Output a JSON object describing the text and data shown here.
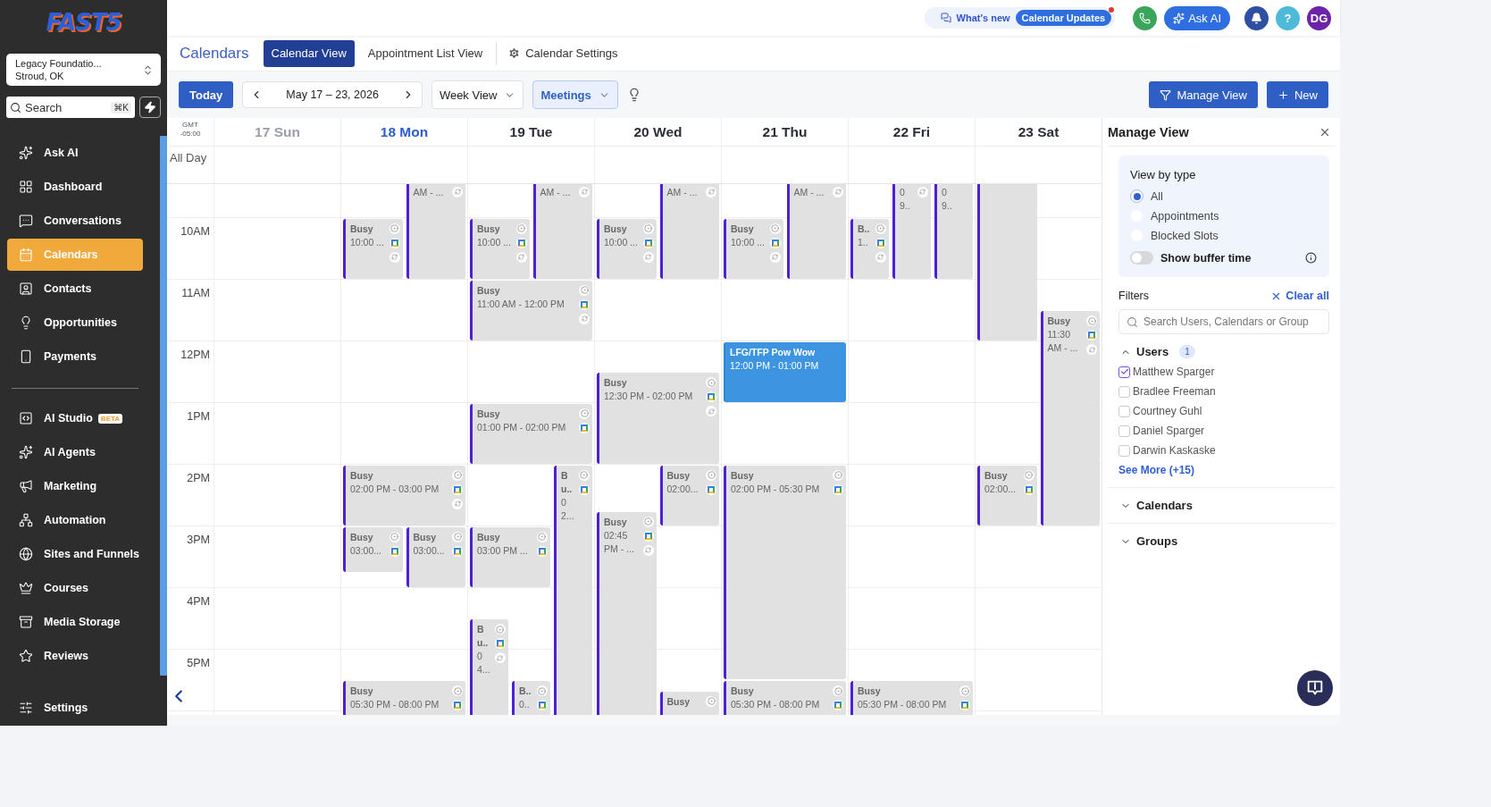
{
  "sidebar": {
    "logo": "FAST5",
    "location": {
      "name": "Legacy Foundatio...",
      "city": "Stroud, OK"
    },
    "search": {
      "placeholder": "Search",
      "shortcut": "⌘K"
    },
    "sections": [
      {
        "items": [
          {
            "label": "Ask AI",
            "selected": false
          },
          {
            "label": "Dashboard",
            "selected": false
          },
          {
            "label": "Conversations",
            "selected": false
          },
          {
            "label": "Calendars",
            "selected": true
          },
          {
            "label": "Contacts",
            "selected": false
          },
          {
            "label": "Opportunities",
            "selected": false
          },
          {
            "label": "Payments",
            "selected": false
          }
        ]
      },
      {
        "items": [
          {
            "label": "AI Studio",
            "badge": "BETA",
            "selected": false
          },
          {
            "label": "AI Agents",
            "selected": false
          },
          {
            "label": "Marketing",
            "selected": false
          },
          {
            "label": "Automation",
            "selected": false
          },
          {
            "label": "Sites and Funnels",
            "selected": false
          },
          {
            "label": "Courses",
            "selected": false
          },
          {
            "label": "Media Storage",
            "selected": false
          },
          {
            "label": "Reviews",
            "selected": false
          }
        ]
      }
    ],
    "footer_items": [
      {
        "label": "Settings",
        "selected": false
      }
    ]
  },
  "topbar": {
    "whats_new": "What's new",
    "updates": {
      "label": "Calendar Updates",
      "unread": true
    },
    "ask_ai": "Ask AI",
    "help": "?",
    "avatar": "DG"
  },
  "header": {
    "title": "Calendars",
    "tabs": [
      {
        "label": "Calendar View",
        "selected": true
      },
      {
        "label": "Appointment List View",
        "selected": false
      }
    ],
    "settings": "Calendar Settings"
  },
  "toolbar": {
    "today": "Today",
    "range": "May 17 – 23, 2026",
    "view": "Week View",
    "filter": "Meetings",
    "manage": "Manage View",
    "new": "New"
  },
  "calendar": {
    "timezone": [
      "GMT",
      "-05:00"
    ],
    "all_day": "All Day",
    "hours": [
      "10AM",
      "11AM",
      "12PM",
      "1PM",
      "2PM",
      "3PM",
      "4PM",
      "5PM"
    ],
    "days": [
      {
        "label": "17 Sun",
        "past": true,
        "today": false
      },
      {
        "label": "18 Mon",
        "past": false,
        "today": true,
        "events": [
          {
            "kind": "busy",
            "time": [
              "AM - ..."
            ]
          },
          {
            "kind": "busy",
            "title": [
              "Busy"
            ],
            "time": [
              "10:00 ..."
            ]
          },
          {
            "kind": "busy",
            "title": [
              "Busy"
            ],
            "time": [
              "02:00 PM - 03:00 PM"
            ]
          },
          {
            "kind": "busy",
            "title": [
              "Busy"
            ],
            "time": [
              "03:00..."
            ]
          },
          {
            "kind": "busy",
            "title": [
              "Busy"
            ],
            "time": [
              "03:00..."
            ]
          },
          {
            "kind": "busy",
            "title": [
              "Busy"
            ],
            "time": [
              "05:30 PM - 08:00 PM"
            ]
          }
        ]
      },
      {
        "label": "19 Tue",
        "past": false,
        "today": false,
        "events": [
          {
            "kind": "busy",
            "time": [
              "AM - ..."
            ]
          },
          {
            "kind": "busy",
            "title": [
              "Busy"
            ],
            "time": [
              "10:00 ..."
            ]
          },
          {
            "kind": "busy",
            "title": [
              "Busy"
            ],
            "time": [
              "11:00 AM - 12:00 PM"
            ]
          },
          {
            "kind": "busy",
            "title": [
              "Busy"
            ],
            "time": [
              "01:00 PM - 02:00 PM"
            ]
          },
          {
            "kind": "busy",
            "title": [
              "B",
              "u.."
            ],
            "time": [
              "0",
              "2..."
            ]
          },
          {
            "kind": "busy",
            "title": [
              "Busy"
            ],
            "time": [
              "03:00 PM ..."
            ]
          },
          {
            "kind": "busy",
            "title": [
              "B",
              "u.."
            ],
            "time": [
              "0",
              "4..."
            ]
          },
          {
            "kind": "busy",
            "title": [
              "B.."
            ],
            "time": [
              "0.."
            ]
          }
        ]
      },
      {
        "label": "20 Wed",
        "past": false,
        "today": false,
        "events": [
          {
            "kind": "busy",
            "time": [
              "AM - ..."
            ]
          },
          {
            "kind": "busy",
            "title": [
              "Busy"
            ],
            "time": [
              "10:00 ..."
            ]
          },
          {
            "kind": "busy",
            "title": [
              "Busy"
            ],
            "time": [
              "12:30 PM - 02:00 PM"
            ]
          },
          {
            "kind": "busy",
            "title": [
              "Busy"
            ],
            "time": [
              "02:00..."
            ]
          },
          {
            "kind": "busy",
            "title": [
              "Busy"
            ],
            "time": [
              "02:45",
              "PM - ..."
            ]
          },
          {
            "kind": "busy",
            "title": [
              "Busy"
            ]
          }
        ]
      },
      {
        "label": "21 Thu",
        "past": false,
        "today": false,
        "events": [
          {
            "kind": "busy",
            "time": [
              "AM - ..."
            ]
          },
          {
            "kind": "busy",
            "title": [
              "Busy"
            ],
            "time": [
              "10:00 ..."
            ]
          },
          {
            "kind": "meeting",
            "title": [
              "LFG/TFP Pow Wow"
            ],
            "time": [
              "12:00 PM - 01:00 PM"
            ]
          },
          {
            "kind": "busy",
            "title": [
              "Busy"
            ],
            "time": [
              "02:00 PM - 05:30 PM"
            ]
          },
          {
            "kind": "busy",
            "title": [
              "Busy"
            ],
            "time": [
              "05:30 PM - 08:00 PM"
            ]
          }
        ]
      },
      {
        "label": "22 Fri",
        "past": false,
        "today": false,
        "events": [
          {
            "kind": "busy",
            "time": [
              "0",
              "9.."
            ]
          },
          {
            "kind": "busy",
            "time": [
              "0",
              "9.."
            ]
          },
          {
            "kind": "busy",
            "title": [
              "B.."
            ],
            "time": [
              "1.."
            ]
          },
          {
            "kind": "busy",
            "title": [
              "Busy"
            ],
            "time": [
              "05:30 PM - 08:00 PM"
            ]
          }
        ]
      },
      {
        "label": "23 Sat",
        "past": false,
        "today": false,
        "events": [
          {
            "kind": "busy"
          },
          {
            "kind": "busy",
            "title": [
              "Busy"
            ],
            "time": [
              "11:30",
              "AM - ..."
            ]
          },
          {
            "kind": "busy",
            "title": [
              "Busy"
            ],
            "time": [
              "02:00..."
            ]
          }
        ]
      }
    ]
  },
  "manage_view": {
    "title": "Manage View",
    "view_by_type": {
      "label": "View by type",
      "options": [
        {
          "label": "All",
          "selected": true
        },
        {
          "label": "Appointments",
          "selected": false
        },
        {
          "label": "Blocked Slots",
          "selected": false
        }
      ],
      "buffer": {
        "label": "Show buffer time",
        "on": false
      }
    },
    "filters": {
      "label": "Filters",
      "clear": "Clear all",
      "search_placeholder": "Search Users, Calendars or Group"
    },
    "groups": [
      {
        "label": "Users",
        "count": "1",
        "expanded": true,
        "items": [
          {
            "label": "Matthew Sparger",
            "checked": true
          },
          {
            "label": "Bradlee Freeman",
            "checked": false
          },
          {
            "label": "Courtney Guhl",
            "checked": false
          },
          {
            "label": "Daniel Sparger",
            "checked": false
          },
          {
            "label": "Darwin Kaskaske",
            "checked": false
          }
        ],
        "more": "See More (+15)"
      },
      {
        "label": "Calendars",
        "expanded": false
      },
      {
        "label": "Groups",
        "expanded": false
      }
    ]
  }
}
